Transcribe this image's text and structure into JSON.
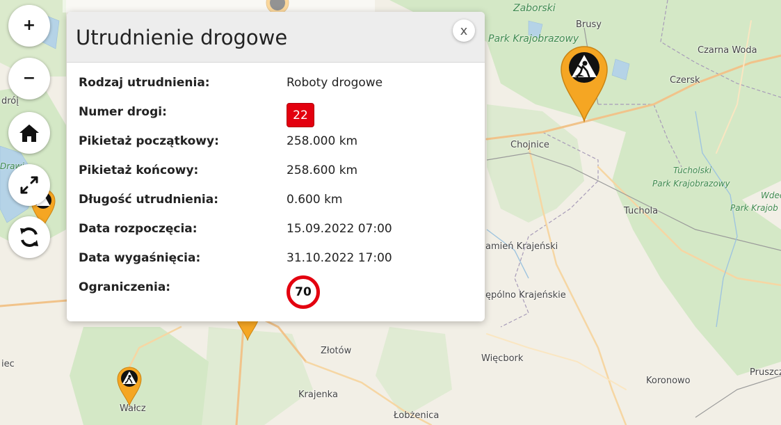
{
  "map": {
    "places": [
      {
        "id": "brusy",
        "name": "Brusy"
      },
      {
        "id": "czarna-woda",
        "name": "Czarna Woda"
      },
      {
        "id": "czersk",
        "name": "Czersk"
      },
      {
        "id": "chojnice",
        "name": "Chojnice"
      },
      {
        "id": "tuchola",
        "name": "Tuchola"
      },
      {
        "id": "kamien",
        "name": "amień Krajeński"
      },
      {
        "id": "sepolno",
        "name": "ępólno Krajeńskie"
      },
      {
        "id": "zlotow",
        "name": "Złotów"
      },
      {
        "id": "wiecbork",
        "name": "Więcbork"
      },
      {
        "id": "koronowo",
        "name": "Koronowo"
      },
      {
        "id": "krajenka",
        "name": "Krajenka"
      },
      {
        "id": "lobzenica",
        "name": "Łobżenica"
      },
      {
        "id": "walcz",
        "name": "Wałcz"
      },
      {
        "id": "pruszcz",
        "name": "Pruszcz"
      },
      {
        "id": "droj",
        "name": "dróį"
      },
      {
        "id": "iec",
        "name": "iec"
      }
    ],
    "parks": [
      {
        "id": "zaborski-1",
        "name": "Zaborski"
      },
      {
        "id": "zaborski-2",
        "name": "Park Krajobrazowy"
      },
      {
        "id": "tucholski-1",
        "name": "Tucholski"
      },
      {
        "id": "tucholski-2",
        "name": "Park Krajobrazowy"
      },
      {
        "id": "wdecki-1",
        "name": "Wdec"
      },
      {
        "id": "wdecki-2",
        "name": "Park Krajob"
      },
      {
        "id": "drawski",
        "name": "Drawi"
      }
    ]
  },
  "controls": {
    "zoom_in": "+",
    "zoom_out": "−"
  },
  "popup": {
    "title": "Utrudnienie drogowe",
    "close_label": "x",
    "rows": [
      {
        "label": "Rodzaj utrudnienia:",
        "value": "Roboty drogowe"
      },
      {
        "label": "Numer drogi:",
        "value": "22"
      },
      {
        "label": "Pikietaż początkowy:",
        "value": "258.000 km"
      },
      {
        "label": "Pikietaż końcowy:",
        "value": "258.600 km"
      },
      {
        "label": "Długość utrudnienia:",
        "value": "0.600 km"
      },
      {
        "label": "Data rozpoczęcia:",
        "value": "15.09.2022 07:00"
      },
      {
        "label": "Data wygaśnięcia:",
        "value": "31.10.2022 17:00"
      },
      {
        "label": "Ograniczenia:",
        "value": "70"
      }
    ]
  },
  "colors": {
    "accent_pin": "#f5a623",
    "road_badge": "#e3000f",
    "forest": "#cfe6c2"
  },
  "icons": {
    "marker": "road-works-icon",
    "home": "home-icon",
    "fullscreen": "fullscreen-icon",
    "refresh": "refresh-icon"
  }
}
